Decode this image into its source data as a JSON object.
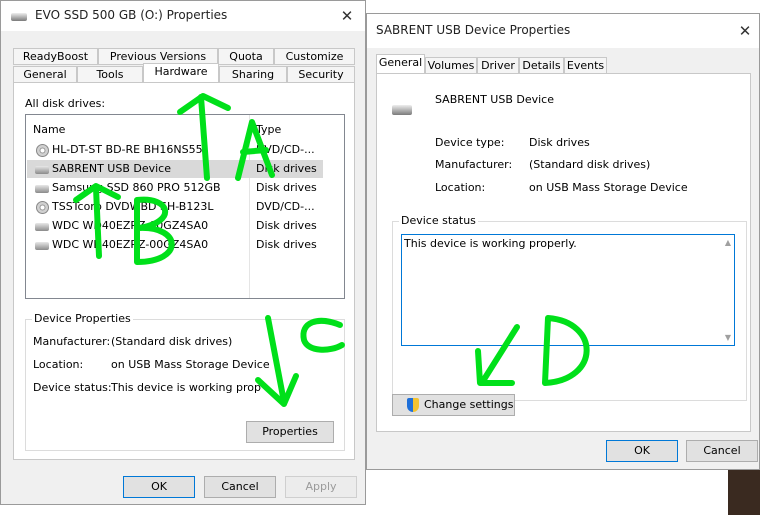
{
  "left_window": {
    "title": "EVO SSD 500 GB (O:) Properties",
    "tabs_row1": [
      "ReadyBoost",
      "Previous Versions",
      "Quota",
      "Customize"
    ],
    "tabs_row2": [
      "General",
      "Tools",
      "Hardware",
      "Sharing",
      "Security"
    ],
    "active_tab": "Hardware",
    "disk_drives_label": "All disk drives:",
    "columns": [
      "Name",
      "Type"
    ],
    "drives": [
      {
        "name": "HL-DT-ST BD-RE  BH16NS55",
        "type": "DVD/CD-...",
        "icon": "disc-drive-icon"
      },
      {
        "name": "SABRENT USB Device",
        "type": "Disk drives",
        "icon": "disk-drive-icon"
      },
      {
        "name": "Samsung SSD 860 PRO 512GB",
        "type": "Disk drives",
        "icon": "disk-drive-icon"
      },
      {
        "name": "TSSTcorp DVDWBD SH-B123L",
        "type": "DVD/CD-...",
        "icon": "disc-drive-icon"
      },
      {
        "name": "WDC WD40EZRZ-00GZ4SA0",
        "type": "Disk drives",
        "icon": "disk-drive-icon"
      },
      {
        "name": "WDC WD40EZRZ-00GZ4SA0",
        "type": "Disk drives",
        "icon": "disk-drive-icon"
      }
    ],
    "device_properties": {
      "group_label": "Device Properties",
      "manufacturer_label": "Manufacturer:",
      "manufacturer_value": "(Standard disk drives)",
      "location_label": "Location:",
      "location_value": "on USB Mass Storage Device",
      "status_label": "Device status:",
      "status_value": "This device is working properly."
    },
    "properties_button": "Properties",
    "ok_button": "OK",
    "cancel_button": "Cancel",
    "apply_button": "Apply"
  },
  "right_window": {
    "title": "SABRENT USB Device Properties",
    "tabs": [
      "General",
      "Volumes",
      "Driver",
      "Details",
      "Events"
    ],
    "active_tab": "General",
    "device_name": "SABRENT USB Device",
    "device_type_label": "Device type:",
    "device_type_value": "Disk drives",
    "manufacturer_label": "Manufacturer:",
    "manufacturer_value": "(Standard disk drives)",
    "location_label": "Location:",
    "location_value": "on USB Mass Storage Device",
    "device_status_label": "Device status",
    "device_status_text": "This device is working properly.",
    "change_settings_button": "Change settings",
    "ok_button": "OK",
    "cancel_button": "Cancel"
  },
  "annotations": {
    "color": "#00e01a",
    "labels": [
      "A",
      "B",
      "C",
      "D"
    ]
  }
}
